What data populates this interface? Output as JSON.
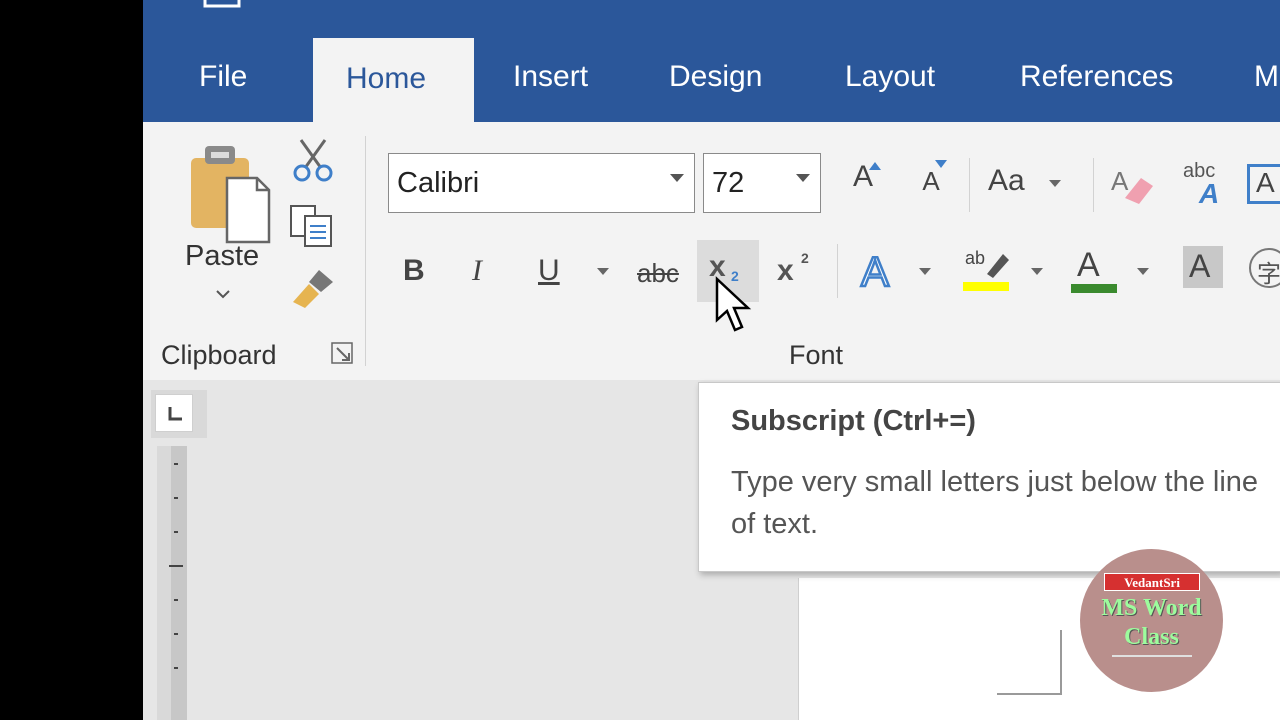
{
  "tabs": {
    "file": "File",
    "home": "Home",
    "insert": "Insert",
    "design": "Design",
    "layout": "Layout",
    "references": "References",
    "mailings_partial": "M"
  },
  "clipboard": {
    "paste_label": "Paste",
    "group_label": "Clipboard"
  },
  "font": {
    "font_name": "Calibri",
    "font_size": "72",
    "group_label": "Font",
    "bold": "B",
    "italic": "I",
    "underline": "U",
    "strikethrough": "abc",
    "subscript": "x",
    "superscript": "x",
    "change_case": "Aa",
    "grow_font": "A",
    "shrink_font": "A",
    "text_effects": "A",
    "highlight_color_hex": "#ffff00",
    "font_color_hex": "#3a8a2e",
    "shading": "A",
    "phonetic": "字",
    "clear_formatting_label": "abc"
  },
  "tooltip": {
    "title": "Subscript (Ctrl+=)",
    "description": "Type very small letters just below the line of text."
  },
  "ruler": {
    "tab_selector": "L"
  },
  "watermark": {
    "brand": "VedantSri",
    "line1": "MS Word",
    "line2": "Class"
  },
  "colors": {
    "title_bar": "#2b579a",
    "ribbon": "#f3f3f3",
    "workspace": "#e6e6e6"
  }
}
